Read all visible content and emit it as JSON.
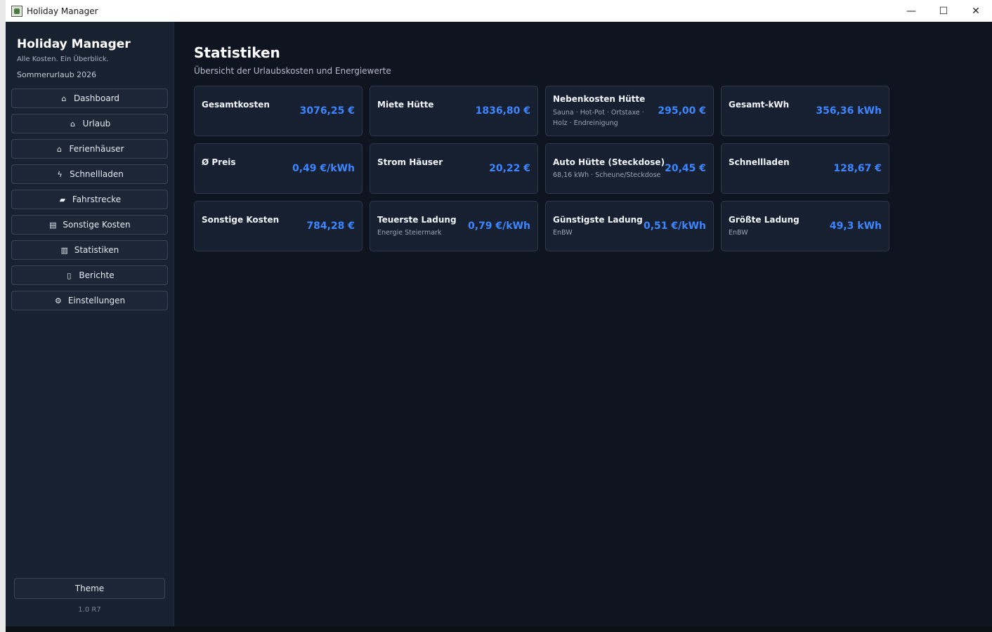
{
  "window": {
    "title": "Holiday Manager"
  },
  "sidebar": {
    "app_name": "Holiday Manager",
    "tagline": "Alle Kosten. Ein Überblick.",
    "trip": "Sommerurlaub 2026",
    "items": [
      {
        "label": "Dashboard",
        "icon": "house-icon",
        "glyph": "⌂"
      },
      {
        "label": "Urlaub",
        "icon": "home-icon",
        "glyph": "⌂"
      },
      {
        "label": "Ferienhäuser",
        "icon": "cabin-icon",
        "glyph": "⌂"
      },
      {
        "label": "Schnellladen",
        "icon": "lightning-icon",
        "glyph": "ϟ"
      },
      {
        "label": "Fahrstrecke",
        "icon": "car-icon",
        "glyph": "▰"
      },
      {
        "label": "Sonstige Kosten",
        "icon": "cart-icon",
        "glyph": "▤"
      },
      {
        "label": "Statistiken",
        "icon": "bar-chart-icon",
        "glyph": "▥"
      },
      {
        "label": "Berichte",
        "icon": "document-icon",
        "glyph": "▯"
      },
      {
        "label": "Einstellungen",
        "icon": "gear-icon",
        "glyph": "⚙"
      }
    ],
    "theme_label": "Theme",
    "version": "1.0 R7"
  },
  "main": {
    "title": "Statistiken",
    "subtitle": "Übersicht der Urlaubskosten und Energiewerte",
    "cards": [
      {
        "label": "Gesamtkosten",
        "sub": "",
        "value": "3076,25 €"
      },
      {
        "label": "Miete Hütte",
        "sub": "",
        "value": "1836,80 €"
      },
      {
        "label": "Nebenkosten Hütte",
        "sub": "Sauna · Hot-Pot · Ortstaxe · Holz · Endreinigung",
        "value": "295,00 €"
      },
      {
        "label": "Gesamt-kWh",
        "sub": "",
        "value": "356,36 kWh"
      },
      {
        "label": "Ø Preis",
        "sub": "",
        "value": "0,49 €/kWh"
      },
      {
        "label": "Strom Häuser",
        "sub": "",
        "value": "20,22 €"
      },
      {
        "label": "Auto Hütte (Steckdose)",
        "sub": "68,16 kWh · Scheune/Steckdose",
        "value": "20,45 €"
      },
      {
        "label": "Schnellladen",
        "sub": "",
        "value": "128,67 €"
      },
      {
        "label": "Sonstige Kosten",
        "sub": "",
        "value": "784,28 €"
      },
      {
        "label": "Teuerste Ladung",
        "sub": "Energie Steiermark",
        "value": "0,79 €/kWh"
      },
      {
        "label": "Günstigste Ladung",
        "sub": "EnBW",
        "value": "0,51 €/kWh"
      },
      {
        "label": "Größte Ladung",
        "sub": "EnBW",
        "value": "49,3 kWh"
      }
    ]
  },
  "colors": {
    "accent": "#3d86ff",
    "background": "#0f1520",
    "sidebar": "#182130",
    "card": "#172030"
  }
}
